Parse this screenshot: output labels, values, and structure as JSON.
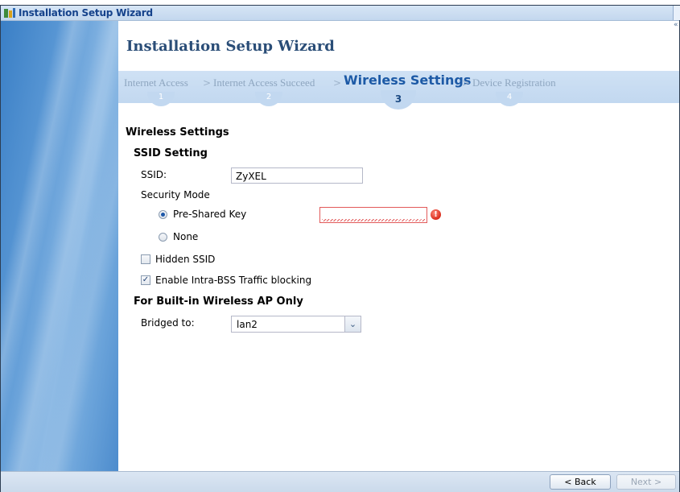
{
  "window": {
    "title": "Installation Setup Wizard"
  },
  "main": {
    "title": "Installation Setup Wizard"
  },
  "steps": [
    {
      "label": "Internet Access",
      "number": "1"
    },
    {
      "label": "Internet Access Succeed",
      "number": "2"
    },
    {
      "label": "Wireless Settings",
      "number": "3"
    },
    {
      "label": "Device Registration",
      "number": "4"
    }
  ],
  "step_separator": ">",
  "form": {
    "section_title": "Wireless Settings",
    "ssid_setting_title": "SSID Setting",
    "ssid_label": "SSID:",
    "ssid_value": "ZyXEL",
    "security_mode_label": "Security Mode",
    "pre_shared_key_label": "Pre-Shared Key",
    "pre_shared_key_value": "",
    "pre_shared_key_selected": true,
    "none_label": "None",
    "hidden_ssid_label": "Hidden SSID",
    "hidden_ssid_checked": false,
    "intra_bss_label": "Enable Intra-BSS Traffic blocking",
    "intra_bss_checked": true,
    "builtin_ap_title": "For Built-in Wireless AP Only",
    "bridged_to_label": "Bridged to:",
    "bridged_to_value": "lan2"
  },
  "footer": {
    "back_label": "< Back",
    "next_label": "Next >"
  },
  "icons": {
    "error": "!",
    "dropdown": "⌄",
    "checkmark": "✓",
    "collapse": "«"
  },
  "colors": {
    "title_blue": "#2a4d77",
    "active_step": "#1d5aa6",
    "error_red": "#e25a5a"
  }
}
